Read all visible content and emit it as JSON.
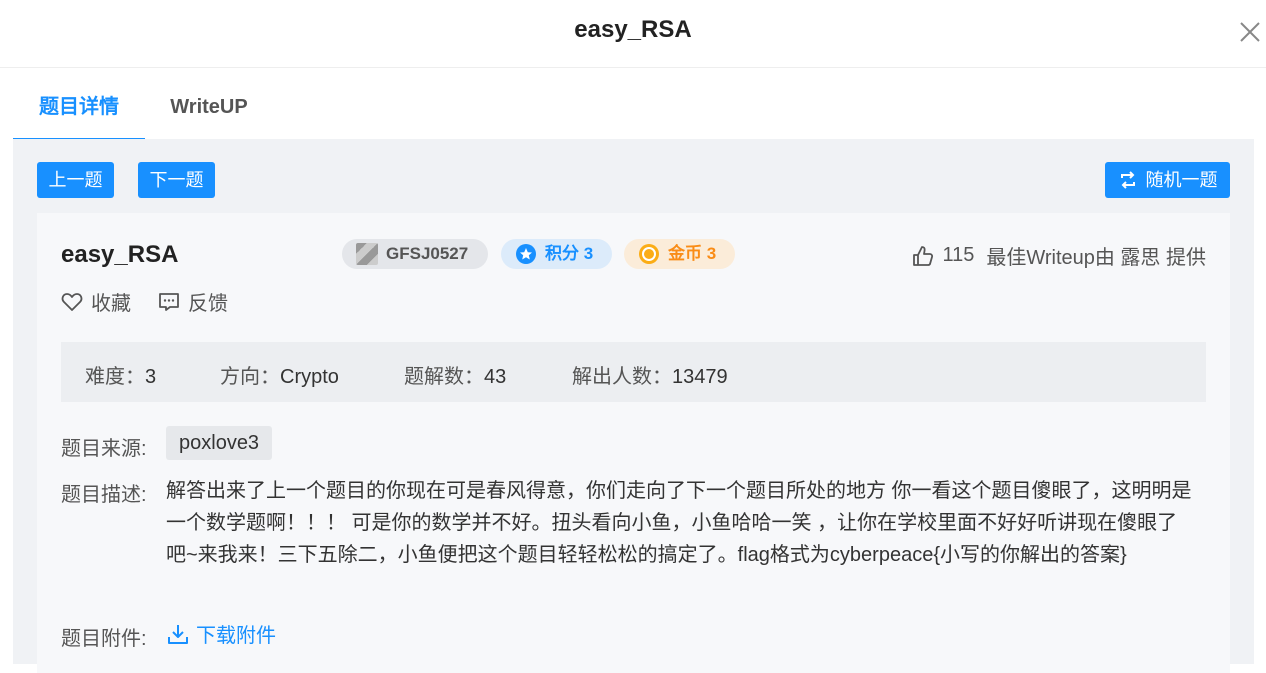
{
  "modal": {
    "title": "easy_RSA"
  },
  "tabs": [
    {
      "label": "题目详情",
      "active": true
    },
    {
      "label": "WriteUP",
      "active": false
    }
  ],
  "nav": {
    "prev": "上一题",
    "next": "下一题",
    "random": "随机一题"
  },
  "challenge": {
    "name": "easy_RSA",
    "author": "GFSJ0527",
    "points_label": "积分 3",
    "coins_label": "金币 3",
    "likes": "115",
    "best_writeup": "最佳Writeup由 露思 提供",
    "favorite": "收藏",
    "feedback": "反馈"
  },
  "stats": {
    "difficulty_label": "难度：",
    "difficulty": "3",
    "direction_label": "方向：",
    "direction": "Crypto",
    "solves_label": "题解数：",
    "solves": "43",
    "solvers_label": "解出人数：",
    "solvers": "13479"
  },
  "source": {
    "label": "题目来源:",
    "value": "poxlove3"
  },
  "description": {
    "label": "题目描述:",
    "text": "解答出来了上一个题目的你现在可是春风得意，你们走向了下一个题目所处的地方 你一看这个题目傻眼了，这明明是一个数学题啊！！！ 可是你的数学并不好。扭头看向小鱼，小鱼哈哈一笑 ，让你在学校里面不好好听讲现在傻眼了吧~来我来！三下五除二，小鱼便把这个题目轻轻松松的搞定了。flag格式为cyberpeace{小写的你解出的答案}"
  },
  "attachment": {
    "label": "题目附件:",
    "link": "下载附件"
  },
  "colors": {
    "accent": "#1890ff",
    "coin": "#fa8c16",
    "panel": "#f0f2f5"
  }
}
